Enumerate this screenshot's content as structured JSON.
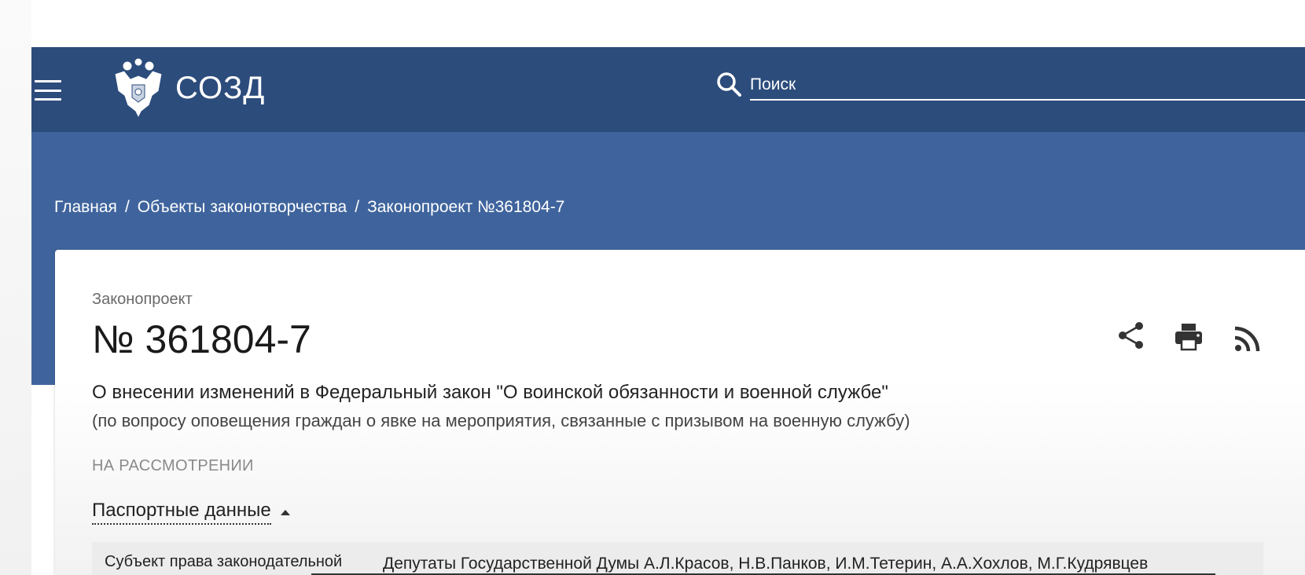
{
  "header": {
    "brand": "СОЗД",
    "search_placeholder": "Поиск"
  },
  "breadcrumb": {
    "items": [
      "Главная",
      "Объекты законотворчества",
      "Законопроект №361804-7"
    ],
    "separator": "/"
  },
  "bill": {
    "type_label": "Законопроект",
    "number": "№ 361804-7",
    "title": "О внесении изменений в Федеральный закон \"О воинской обязанности и военной службе\"",
    "subtitle": "(по вопросу оповещения граждан о явке на мероприятия, связанные с призывом на военную службу)",
    "status": "НА РАССМОТРЕНИИ"
  },
  "passport": {
    "toggle_label": "Паспортные данные",
    "row_label": "Субъект права законодательной",
    "row_value": "Депутаты Государственной Думы А.Л.Красов, Н.В.Панков, И.М.Тетерин, А.А.Хохлов, М.Г.Кудрявцев"
  },
  "icons": {
    "menu": "hamburger-icon",
    "logo": "coat-of-arms-icon",
    "search": "search-icon",
    "share": "share-icon",
    "print": "print-icon",
    "rss": "rss-icon"
  },
  "colors": {
    "topbar": "#2c4c7c",
    "hero": "#3f649d",
    "text_dark": "#222222",
    "status_gray": "#8a8a8a"
  }
}
